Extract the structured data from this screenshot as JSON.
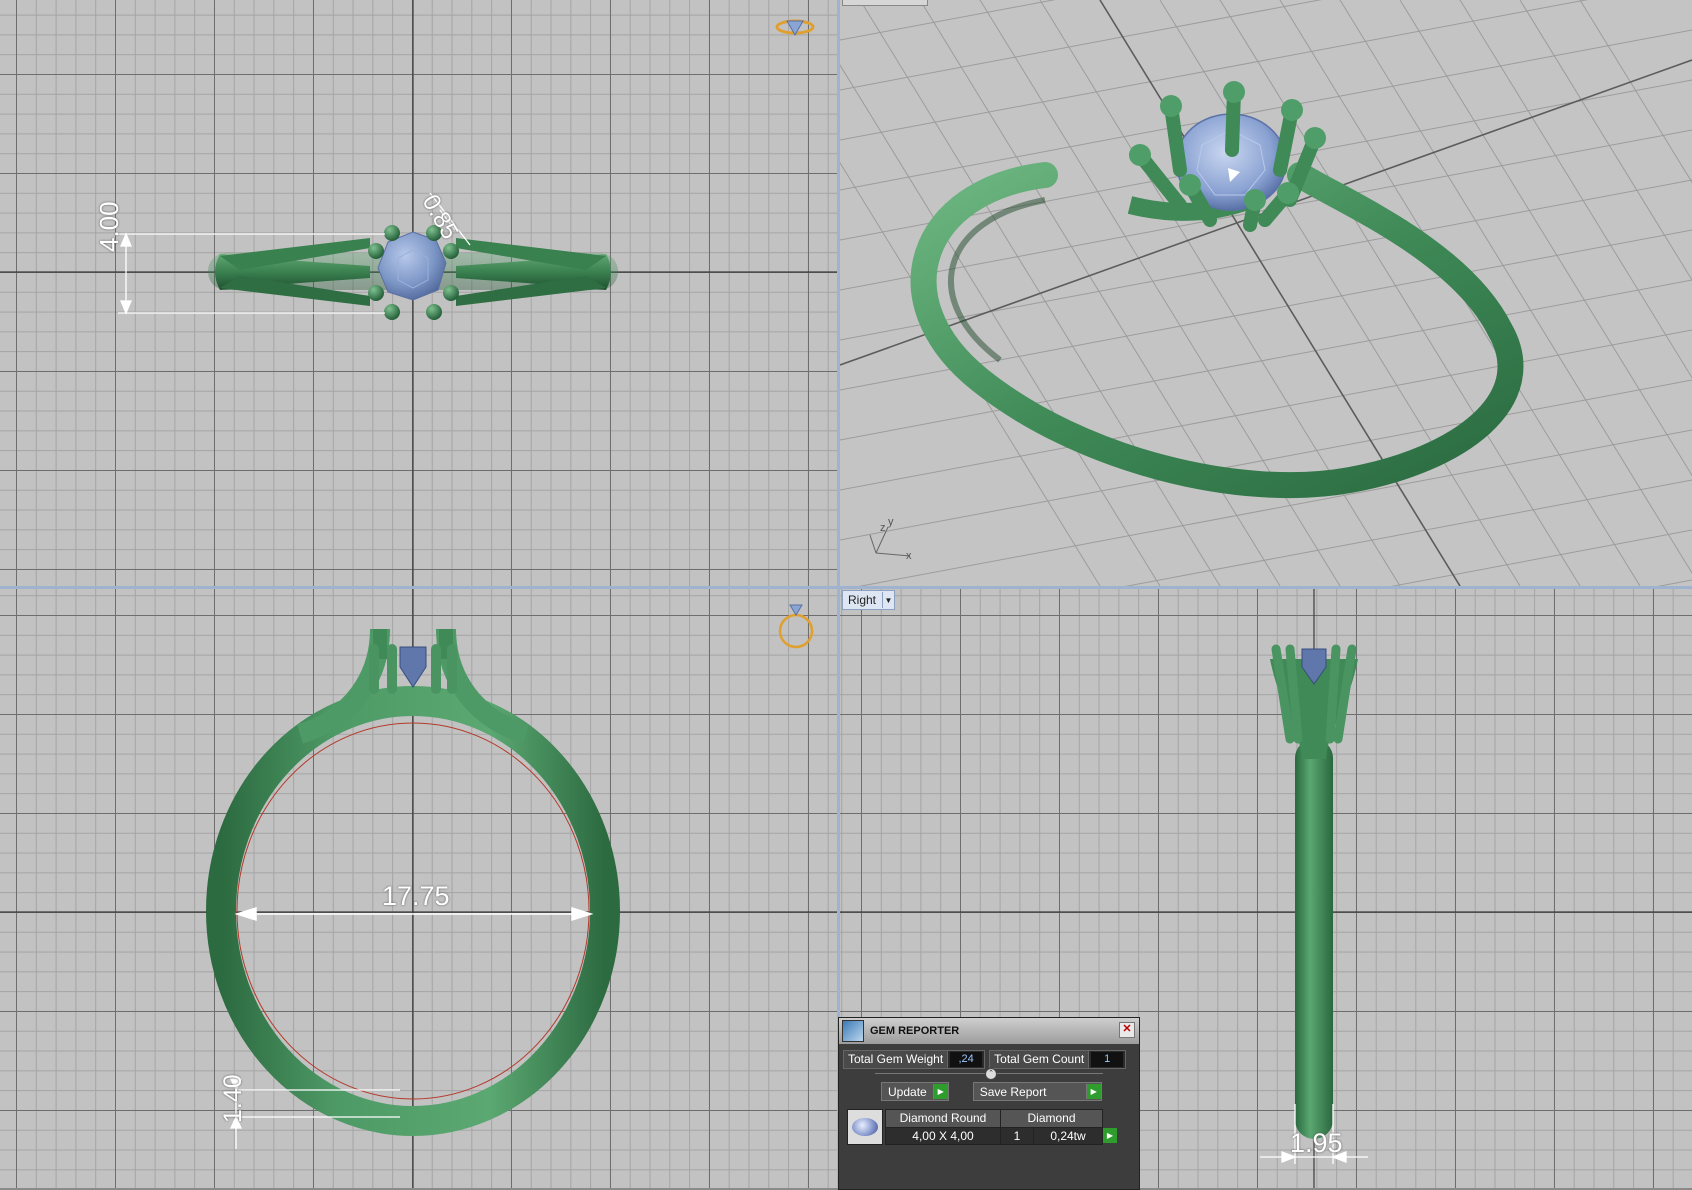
{
  "viewports": {
    "right_label": "Right",
    "right_dropdown_icon": "chevron-down-icon",
    "persp_axis": {
      "z": "z",
      "y": "y",
      "x": "x"
    }
  },
  "dimensions": {
    "top_width": "4.00",
    "top_prong": "0.85",
    "front_inner_diameter": "17.75",
    "front_shank_thickness": "1.40",
    "right_shank_width": "1.95"
  },
  "gem_reporter": {
    "title": "GEM REPORTER",
    "close_icon": "close-icon",
    "total_gem_weight_label": "Total Gem Weight",
    "total_gem_weight_value": ",24",
    "total_gem_count_label": "Total Gem Count",
    "total_gem_count_value": "1",
    "update_label": "Update",
    "save_report_label": "Save Report",
    "table": {
      "headers": [
        "Diamond Round",
        "Diamond"
      ],
      "row": [
        "4,00 X 4,00",
        "1",
        "0,24tw"
      ]
    }
  },
  "colors": {
    "metal": "#3e8c58",
    "gem": "#7e98c8",
    "grid_bg": "#c2c2c2",
    "separator": "#9fb3cf",
    "gizmo": "#e0a030"
  }
}
